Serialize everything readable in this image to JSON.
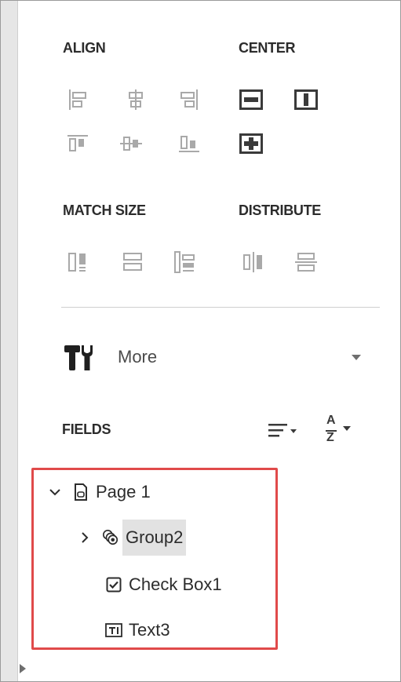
{
  "sections": {
    "align": "ALIGN",
    "center": "CENTER",
    "match_size": "MATCH SIZE",
    "distribute": "DISTRIBUTE",
    "fields": "FIELDS"
  },
  "more": {
    "label": "More"
  },
  "tree": {
    "page": "Page 1",
    "group": "Group2",
    "checkbox": "Check Box1",
    "text": "Text3"
  },
  "sort_az": {
    "top": "A",
    "bottom": "Z"
  },
  "colors": {
    "highlight_border": "#e04a4a",
    "icon_gray": "#a9a9a9",
    "icon_dark": "#3a3a3a",
    "selected_bg": "#e2e2e2"
  }
}
